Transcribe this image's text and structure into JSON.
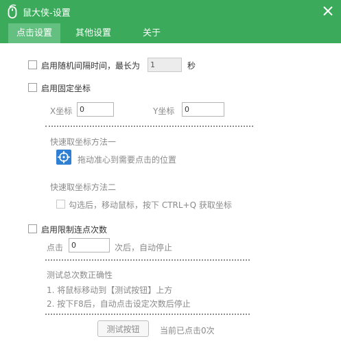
{
  "window": {
    "title": "鼠大侠-设置"
  },
  "tabs": [
    {
      "label": "点击设置",
      "active": true
    },
    {
      "label": "其他设置",
      "active": false
    },
    {
      "label": "关于",
      "active": false
    }
  ],
  "random_interval": {
    "label": "启用随机间隔时间，最长为",
    "value": "1",
    "unit": "秒",
    "checked": false
  },
  "fixed_coord": {
    "label": "启用固定坐标",
    "checked": false,
    "x_label": "X坐标",
    "x_value": "0",
    "y_label": "Y坐标",
    "y_value": "0",
    "method1_title": "快速取坐标方法一",
    "method1_desc": "拖动准心到需要点击的位置",
    "method2_title": "快速取坐标方法二",
    "method2_desc": "勾选后，移动鼠标，按下 CTRL+Q 获取坐标",
    "method2_checked": false
  },
  "limit_clicks": {
    "label": "启用限制连点次数",
    "checked": false,
    "count_label": "点击",
    "count_value": "0",
    "count_suffix": "次后，自动停止",
    "test_title": "测试总次数正确性",
    "step1": "1. 将鼠标移动到【测试按钮】上方",
    "step2": "2. 按下F8后，自动点击设定次数后停止",
    "test_button": "测试按钮",
    "status": "当前已点击0次"
  },
  "colors": {
    "brand": "#3bab5b",
    "active_tab": "#64c080",
    "target_icon": "#2f7fd3"
  }
}
